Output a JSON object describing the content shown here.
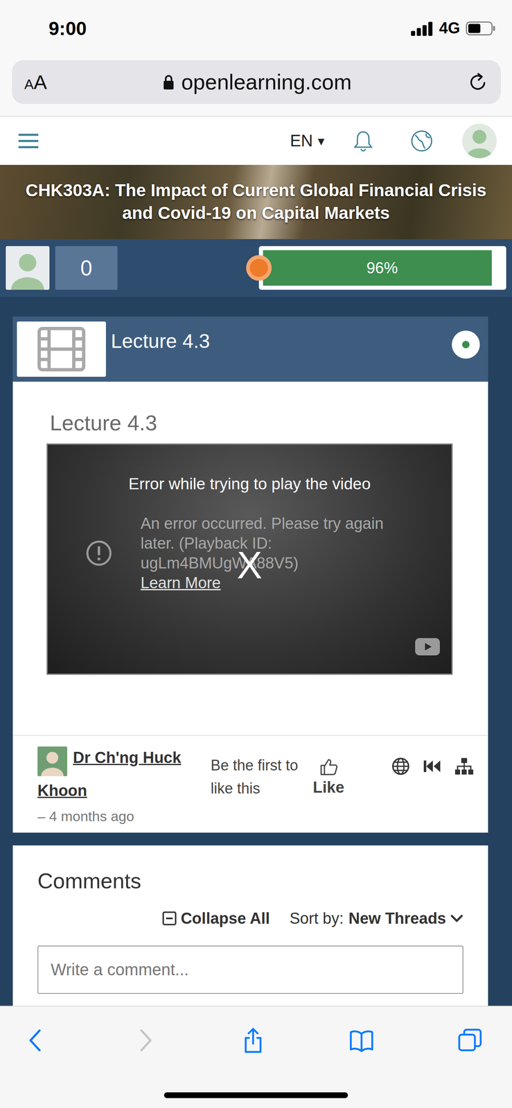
{
  "status_bar": {
    "time": "9:00",
    "network": "4G",
    "signal": {
      "level": 1
    },
    "battery": {
      "level": 0.55
    }
  },
  "browser": {
    "text_size_button": "AA",
    "url": "openlearning.com",
    "toolbar": [
      {
        "kind": "back",
        "disabled": false
      },
      {
        "kind": "forward",
        "disabled": true
      },
      {
        "kind": "share",
        "disabled": false
      },
      {
        "kind": "bookmarks",
        "disabled": false
      },
      {
        "kind": "tabs",
        "disabled": false
      }
    ]
  },
  "nav": {
    "language": "EN",
    "language_menu_icon": "▾"
  },
  "course": {
    "title": "CHK303A: The Impact of Current Global Financial Crisis and Covid-19 on Capital Markets",
    "points": "0",
    "progress": {
      "level": 0.96,
      "label": "96%"
    }
  },
  "lecture": {
    "header": "Lecture 4.3",
    "completed": true,
    "title": "Lecture 4.3",
    "video": {
      "error_title": "Error while trying to play the video",
      "error_message": "An error occurred. Please try again later. (Playback ID: ugLm4BMUgWA88V5)",
      "learn_more": "Learn More",
      "close": "X"
    },
    "author": {
      "name": "Dr Ch'ng Huck Khoon",
      "time": "– 4 months ago"
    },
    "likes": {
      "text": "Be the first to like this",
      "button": "Like"
    }
  },
  "comments": {
    "title": "Comments",
    "collapse": "Collapse All",
    "sort_label": "Sort by:",
    "sort_value": "New Threads",
    "placeholder": "Write a comment..."
  }
}
